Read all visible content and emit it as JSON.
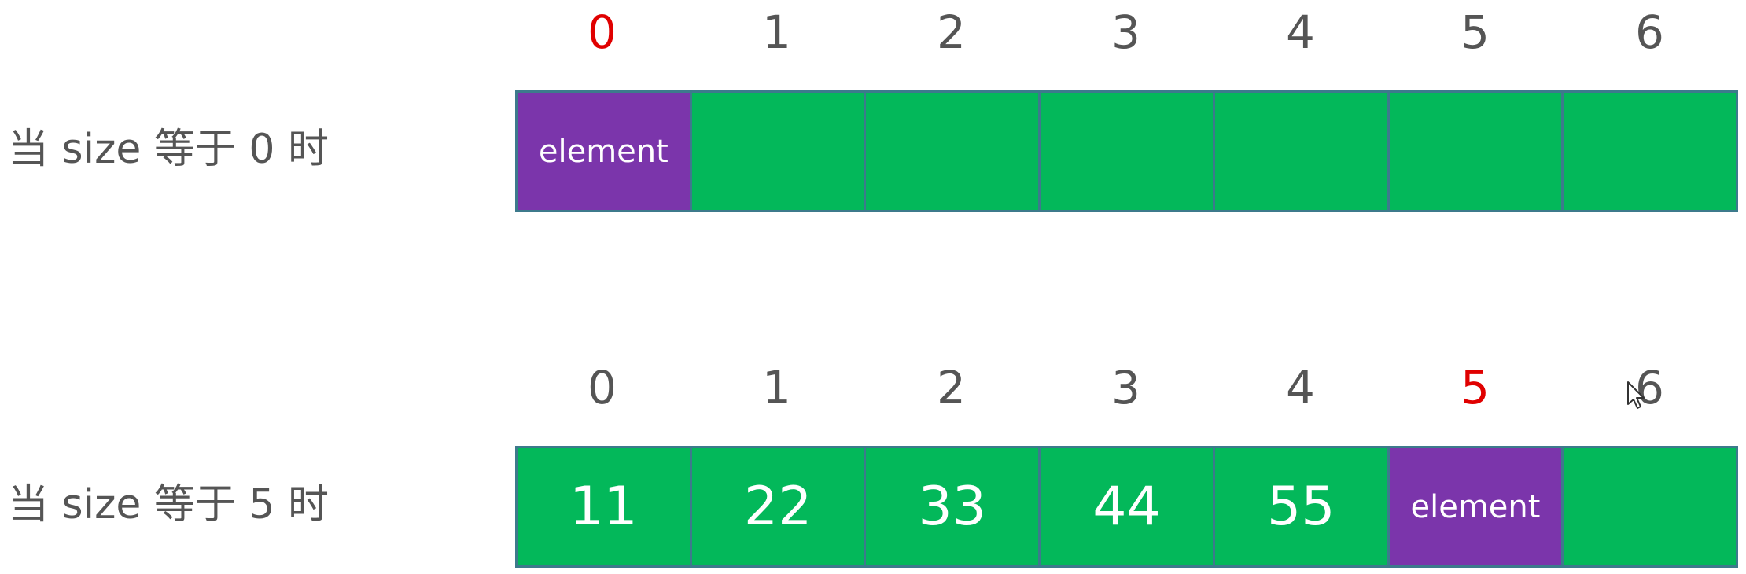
{
  "colors": {
    "cell_fill": "#03b85a",
    "cell_border": "#3d7a8c",
    "element_fill": "#7b35ab",
    "index_text": "#555555",
    "index_highlight": "#e00000",
    "cell_text": "#ffffff"
  },
  "rows": [
    {
      "label": "当 size 等于 0 时",
      "highlight_index": 0,
      "indices": [
        "0",
        "1",
        "2",
        "3",
        "4",
        "5",
        "6"
      ],
      "cells": [
        {
          "text": "element",
          "kind": "element"
        },
        {
          "text": "",
          "kind": "empty"
        },
        {
          "text": "",
          "kind": "empty"
        },
        {
          "text": "",
          "kind": "empty"
        },
        {
          "text": "",
          "kind": "empty"
        },
        {
          "text": "",
          "kind": "empty"
        },
        {
          "text": "",
          "kind": "empty"
        }
      ]
    },
    {
      "label": "当 size 等于 5 时",
      "highlight_index": 5,
      "indices": [
        "0",
        "1",
        "2",
        "3",
        "4",
        "5",
        "6"
      ],
      "cells": [
        {
          "text": "11",
          "kind": "value"
        },
        {
          "text": "22",
          "kind": "value"
        },
        {
          "text": "33",
          "kind": "value"
        },
        {
          "text": "44",
          "kind": "value"
        },
        {
          "text": "55",
          "kind": "value"
        },
        {
          "text": "element",
          "kind": "element"
        },
        {
          "text": "",
          "kind": "empty"
        }
      ]
    }
  ]
}
